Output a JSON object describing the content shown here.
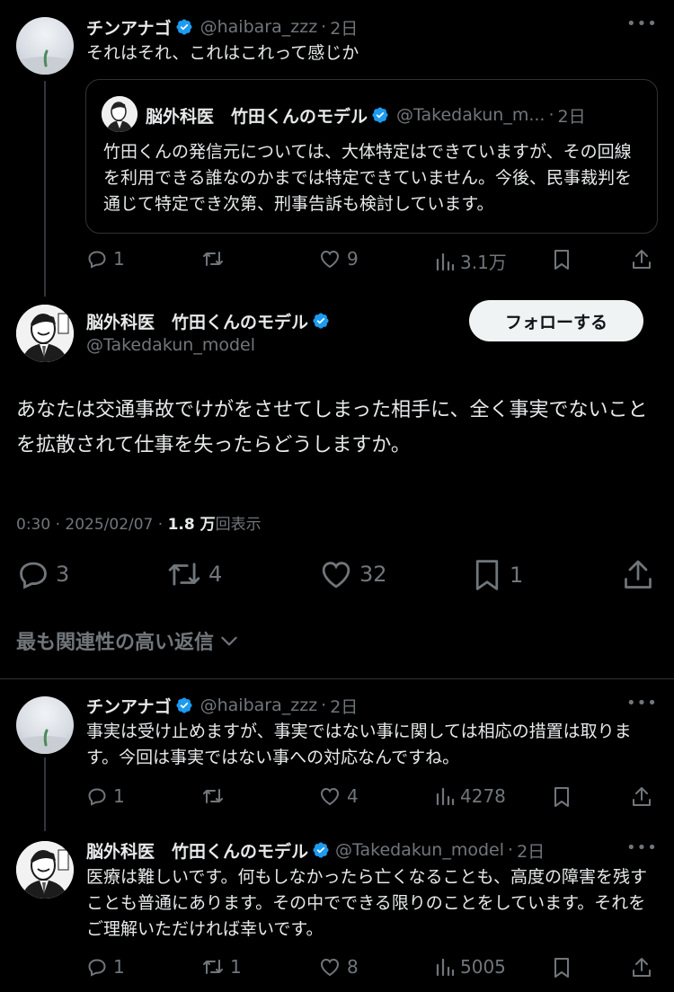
{
  "post1": {
    "name": "チンアナゴ",
    "handle": "@haibara_zzz",
    "time": "2日",
    "text": "それはそれ、これはこれって感じか",
    "quote": {
      "name": "脳外科医　竹田くんのモデル",
      "handle": "@Takedakun_m...",
      "time": "2日",
      "text": "竹田くんの発信元については、大体特定はできていますが、その回線を利用できる誰なのかまでは特定できていません。今後、民事裁判を通じて特定でき次第、刑事告訴も検討しています。"
    },
    "replies": "1",
    "likes": "9",
    "views": "3.1万"
  },
  "main": {
    "name": "脳外科医　竹田くんのモデル",
    "handle": "@Takedakun_model",
    "follow_label": "フォローする",
    "text": "あなたは交通事故でけがをさせてしまった相手に、全く事実でないことを拡散されて仕事を失ったらどうしますか。",
    "timestamp": "0:30 · 2025/02/07 · ",
    "views_count": "1.8 万",
    "views_label": "回表示",
    "replies": "3",
    "reposts": "4",
    "likes": "32",
    "bookmarks": "1"
  },
  "sort_label": "最も関連性の高い返信",
  "reply1": {
    "name": "チンアナゴ",
    "handle": "@haibara_zzz",
    "time": "2日",
    "text": "事実は受け止めますが、事実ではない事に関しては相応の措置は取ります。今回は事実ではない事への対応なんですね。",
    "replies": "1",
    "likes": "4",
    "views": "4278"
  },
  "reply2": {
    "name": "脳外科医　竹田くんのモデル",
    "handle": "@Takedakun_model",
    "time": "2日",
    "text": "医療は難しいです。何もしなかったら亡くなることも、高度の障害を残すことも普通にあります。その中でできる限りのことをしています。それをご理解いただければ幸いです。",
    "replies": "1",
    "reposts": "1",
    "likes": "8",
    "views": "5005"
  },
  "colors": {
    "background": "#000000",
    "text": "#e7e9ea",
    "muted": "#71767b",
    "verified": "#1d9bf0",
    "follow_button": "#eff3f4"
  },
  "icons": [
    "verified-badge-icon",
    "reply-icon",
    "repost-icon",
    "like-icon",
    "views-icon",
    "bookmark-icon",
    "share-icon",
    "more-icon",
    "chevron-down-icon"
  ]
}
